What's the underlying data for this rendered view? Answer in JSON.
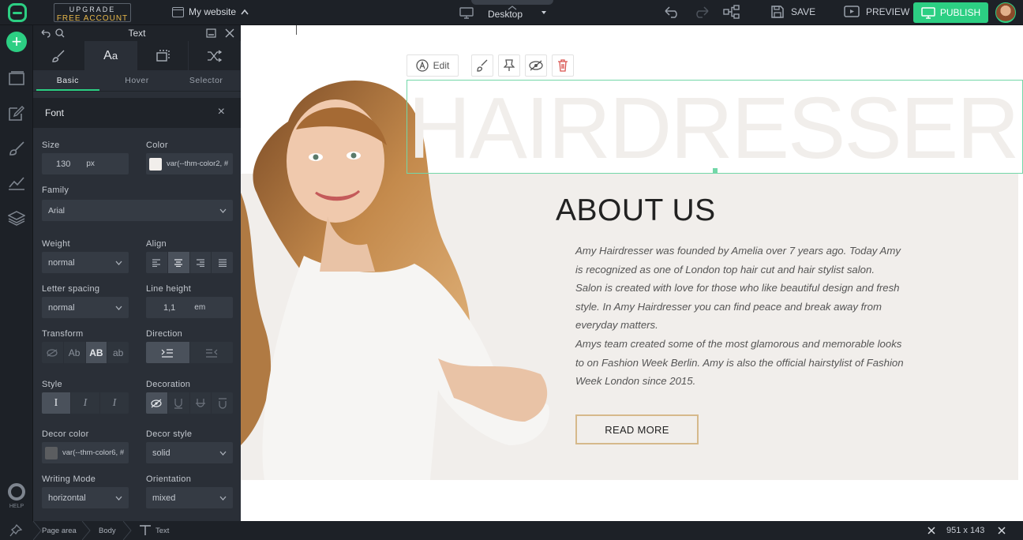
{
  "topbar": {
    "upgrade_line1": "UPGRADE",
    "upgrade_line2": "FREE ACCOUNT",
    "site_name": "My website",
    "device": "Desktop",
    "save": "SAVE",
    "preview": "PREVIEW",
    "publish": "PUBLISH"
  },
  "rail": {
    "help": "HELP"
  },
  "panel": {
    "title": "Text",
    "state_tabs": [
      "Basic",
      "Hover",
      "Selector"
    ],
    "section": "Font",
    "size_label": "Size",
    "size_value": "130",
    "size_unit": "px",
    "color_label": "Color",
    "color_value": "var(--thm-color2, #",
    "family_label": "Family",
    "family_value": "Arial",
    "weight_label": "Weight",
    "weight_value": "normal",
    "align_label": "Align",
    "letter_label": "Letter spacing",
    "letter_value": "normal",
    "line_label": "Line height",
    "line_value": "1,1",
    "line_unit": "em",
    "transform_label": "Transform",
    "transform_opts": [
      "Ab",
      "AB",
      "ab"
    ],
    "direction_label": "Direction",
    "style_label": "Style",
    "decoration_label": "Decoration",
    "decor_color_label": "Decor color",
    "decor_color_value": "var(--thm-color6, #",
    "decor_style_label": "Decor style",
    "decor_style_value": "solid",
    "writing_label": "Writing Mode",
    "writing_value": "horizontal",
    "orientation_label": "Orientation",
    "orientation_value": "mixed"
  },
  "canvas": {
    "edit": "Edit",
    "headline": "HAIRDRESSER",
    "about": "ABOUT US",
    "paragraph": [
      "Amy Hairdresser was founded by Amelia over 7 years ago. Today Amy",
      "is recognized as one of London top hair cut and hair stylist salon.",
      "Salon is created with love for those who like beautiful design and fresh",
      "style. In Amy Hairdresser you can find peace and break away from",
      "everyday matters.",
      "Amys team created some of the most glamorous and memorable looks",
      "to on Fashion Week Berlin. Amy is also the official hairstylist of Fashion",
      "Week London since 2015."
    ],
    "read_more": "READ MORE"
  },
  "bottombar": {
    "crumbs": [
      "Page area",
      "Body",
      "Text"
    ],
    "dimensions": "951 x 143"
  },
  "colors": {
    "accent": "#2ccf83",
    "gold": "#e8b84a",
    "canvas_beige": "#f1eeeb",
    "button_border": "#d6b98b"
  }
}
